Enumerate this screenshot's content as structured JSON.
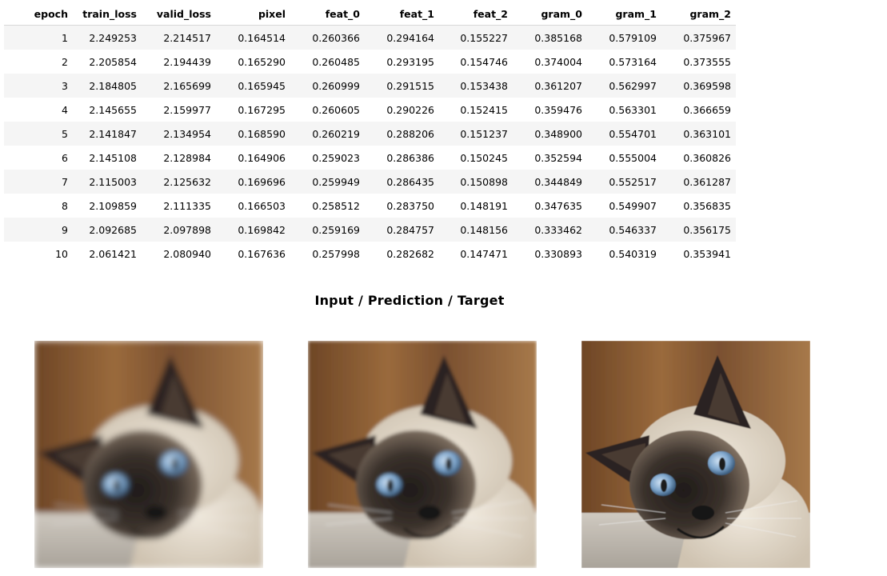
{
  "table": {
    "columns": [
      "epoch",
      "train_loss",
      "valid_loss",
      "pixel",
      "feat_0",
      "feat_1",
      "feat_2",
      "gram_0",
      "gram_1",
      "gram_2"
    ],
    "rows": [
      [
        "1",
        "2.249253",
        "2.214517",
        "0.164514",
        "0.260366",
        "0.294164",
        "0.155227",
        "0.385168",
        "0.579109",
        "0.375967"
      ],
      [
        "2",
        "2.205854",
        "2.194439",
        "0.165290",
        "0.260485",
        "0.293195",
        "0.154746",
        "0.374004",
        "0.573164",
        "0.373555"
      ],
      [
        "3",
        "2.184805",
        "2.165699",
        "0.165945",
        "0.260999",
        "0.291515",
        "0.153438",
        "0.361207",
        "0.562997",
        "0.369598"
      ],
      [
        "4",
        "2.145655",
        "2.159977",
        "0.167295",
        "0.260605",
        "0.290226",
        "0.152415",
        "0.359476",
        "0.563301",
        "0.366659"
      ],
      [
        "5",
        "2.141847",
        "2.134954",
        "0.168590",
        "0.260219",
        "0.288206",
        "0.151237",
        "0.348900",
        "0.554701",
        "0.363101"
      ],
      [
        "6",
        "2.145108",
        "2.128984",
        "0.164906",
        "0.259023",
        "0.286386",
        "0.150245",
        "0.352594",
        "0.555004",
        "0.360826"
      ],
      [
        "7",
        "2.115003",
        "2.125632",
        "0.169696",
        "0.259949",
        "0.286435",
        "0.150898",
        "0.344849",
        "0.552517",
        "0.361287"
      ],
      [
        "8",
        "2.109859",
        "2.111335",
        "0.166503",
        "0.258512",
        "0.283750",
        "0.148191",
        "0.347635",
        "0.549907",
        "0.356835"
      ],
      [
        "9",
        "2.092685",
        "2.097898",
        "0.169842",
        "0.259169",
        "0.284757",
        "0.148156",
        "0.333462",
        "0.546337",
        "0.356175"
      ],
      [
        "10",
        "2.061421",
        "2.080940",
        "0.167636",
        "0.257998",
        "0.282682",
        "0.147471",
        "0.330893",
        "0.540319",
        "0.353941"
      ]
    ]
  },
  "figure": {
    "title": "Input / Prediction / Target",
    "panels": [
      {
        "role": "input",
        "subject": "siamese-cat-photo",
        "quality": "low-resolution"
      },
      {
        "role": "prediction",
        "subject": "siamese-cat-photo",
        "quality": "medium-resolution"
      },
      {
        "role": "target",
        "subject": "siamese-cat-photo",
        "quality": "high-resolution"
      }
    ]
  },
  "colors": {
    "row_stripe": "#f5f5f5",
    "header_rule": "#d8d8d8",
    "background_wood": "#8a5c34",
    "fur_cream": "#e4dccd",
    "mask_dark": "#2a2522",
    "eye_blue": "#8fb3d6",
    "carpet": "#bdb7ae"
  }
}
